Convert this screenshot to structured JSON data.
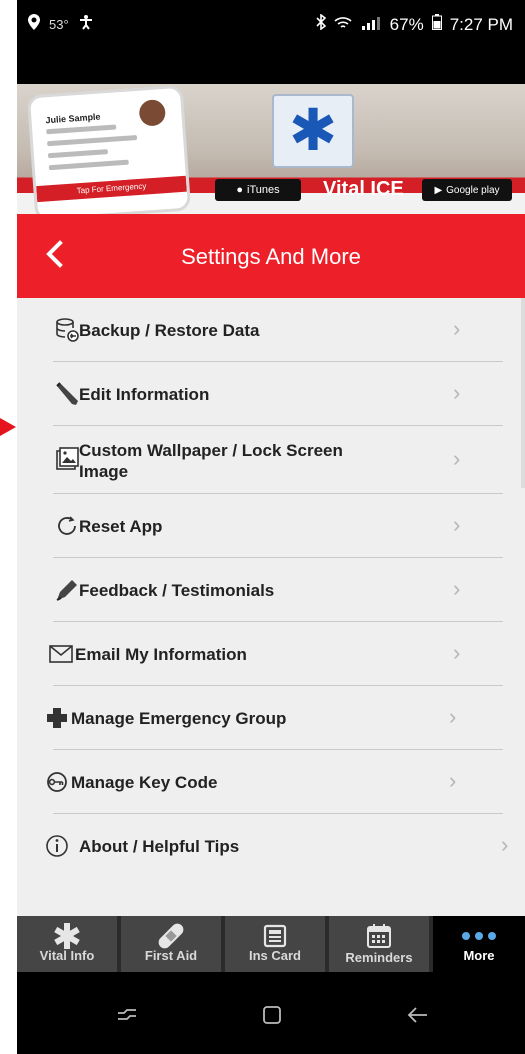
{
  "status_bar": {
    "temperature": "53°",
    "battery": "67%",
    "time": "7:27 PM"
  },
  "banner": {
    "brand": "Vital ICE",
    "app_store": "iTunes",
    "google_play": "Google play",
    "phone_mock_name": "Julie Sample",
    "phone_mock_cta": "Tap For Emergency"
  },
  "header": {
    "title": "Settings And More"
  },
  "menu": {
    "items": [
      {
        "label": "Backup / Restore Data",
        "icon": "database-icon"
      },
      {
        "label": "Edit Information",
        "icon": "pencil-icon"
      },
      {
        "label": "Custom Wallpaper / Lock Screen Image",
        "icon": "image-icon"
      },
      {
        "label": "Reset App",
        "icon": "refresh-icon"
      },
      {
        "label": "Feedback / Testimonials",
        "icon": "pen-icon"
      },
      {
        "label": "Email My Information",
        "icon": "envelope-icon"
      },
      {
        "label": "Manage Emergency Group",
        "icon": "plus-icon"
      },
      {
        "label": "Manage Key Code",
        "icon": "key-icon"
      },
      {
        "label": "About / Helpful Tips",
        "icon": "info-icon"
      }
    ]
  },
  "tabs": [
    {
      "label": "Vital Info",
      "icon": "asterisk-icon"
    },
    {
      "label": "First Aid",
      "icon": "bandage-icon"
    },
    {
      "label": "Ins Card",
      "icon": "card-icon"
    },
    {
      "label": "Reminders",
      "icon": "calendar-icon"
    },
    {
      "label": "More",
      "icon": "more-dots-icon"
    }
  ],
  "colors": {
    "header_red": "#ed1f29",
    "tab_active": "#000000",
    "tab_inactive": "#454545"
  }
}
